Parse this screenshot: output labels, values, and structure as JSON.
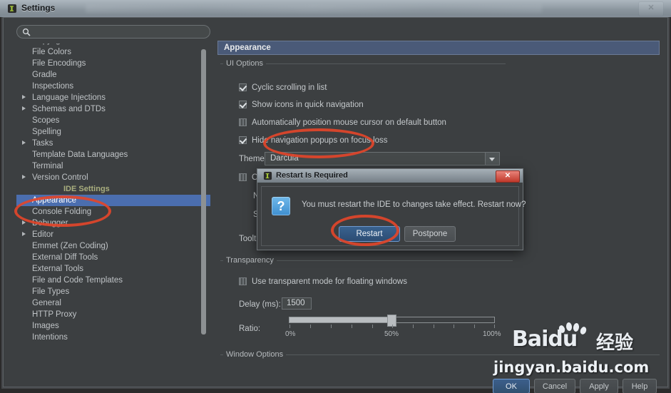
{
  "window": {
    "title": "Settings",
    "app_icon": "intellij-icon",
    "close_label": "✕"
  },
  "search": {
    "value": "",
    "placeholder": "",
    "icon": "search-icon"
  },
  "tree": {
    "items": [
      {
        "label": "Copyright",
        "expandable": true,
        "selected": false,
        "group": false
      },
      {
        "label": "File Colors",
        "expandable": false,
        "selected": false,
        "group": false
      },
      {
        "label": "File Encodings",
        "expandable": false,
        "selected": false,
        "group": false
      },
      {
        "label": "Gradle",
        "expandable": false,
        "selected": false,
        "group": false
      },
      {
        "label": "Inspections",
        "expandable": false,
        "selected": false,
        "group": false
      },
      {
        "label": "Language Injections",
        "expandable": true,
        "selected": false,
        "group": false
      },
      {
        "label": "Schemas and DTDs",
        "expandable": true,
        "selected": false,
        "group": false
      },
      {
        "label": "Scopes",
        "expandable": false,
        "selected": false,
        "group": false
      },
      {
        "label": "Spelling",
        "expandable": false,
        "selected": false,
        "group": false
      },
      {
        "label": "Tasks",
        "expandable": true,
        "selected": false,
        "group": false
      },
      {
        "label": "Template Data Languages",
        "expandable": false,
        "selected": false,
        "group": false
      },
      {
        "label": "Terminal",
        "expandable": false,
        "selected": false,
        "group": false
      },
      {
        "label": "Version Control",
        "expandable": true,
        "selected": false,
        "group": false
      },
      {
        "label": "IDE Settings",
        "expandable": false,
        "selected": false,
        "group": true
      },
      {
        "label": "Appearance",
        "expandable": false,
        "selected": true,
        "group": false
      },
      {
        "label": "Console Folding",
        "expandable": false,
        "selected": false,
        "group": false
      },
      {
        "label": "Debugger",
        "expandable": true,
        "selected": false,
        "group": false
      },
      {
        "label": "Editor",
        "expandable": true,
        "selected": false,
        "group": false
      },
      {
        "label": "Emmet (Zen Coding)",
        "expandable": false,
        "selected": false,
        "group": false
      },
      {
        "label": "External Diff Tools",
        "expandable": false,
        "selected": false,
        "group": false
      },
      {
        "label": "External Tools",
        "expandable": false,
        "selected": false,
        "group": false
      },
      {
        "label": "File and Code Templates",
        "expandable": false,
        "selected": false,
        "group": false
      },
      {
        "label": "File Types",
        "expandable": false,
        "selected": false,
        "group": false
      },
      {
        "label": "General",
        "expandable": false,
        "selected": false,
        "group": false
      },
      {
        "label": "HTTP Proxy",
        "expandable": false,
        "selected": false,
        "group": false
      },
      {
        "label": "Images",
        "expandable": false,
        "selected": false,
        "group": false
      },
      {
        "label": "Intentions",
        "expandable": false,
        "selected": false,
        "group": false
      }
    ]
  },
  "pane": {
    "header": "Appearance"
  },
  "ui_options": {
    "legend": "UI Options",
    "checkboxes": [
      {
        "label": "Cyclic scrolling in list",
        "checked": true
      },
      {
        "label": "Show icons in quick navigation",
        "checked": true
      },
      {
        "label": "Automatically position mouse cursor on default button",
        "checked": false
      },
      {
        "label": "Hide navigation popups on focus loss",
        "checked": true
      }
    ],
    "theme_label": "Theme:",
    "theme_value": "Darcula",
    "override_fonts_label": "Override default fonts by (not recommended):",
    "override_fonts_checked": false,
    "name_label": "Na",
    "size_label": "Siz",
    "tooltip_label": "Tooltip"
  },
  "transparency": {
    "legend": "Transparency",
    "checkbox_label": "Use transparent mode for floating windows",
    "checkbox_checked": false,
    "delay_label": "Delay (ms):",
    "delay_value": "1500",
    "ratio_label": "Ratio:",
    "ratio_percent": 50,
    "tick_labels": [
      "0%",
      "50%",
      "100%"
    ]
  },
  "window_options": {
    "legend": "Window Options"
  },
  "dialog": {
    "title": "Restart Is Required",
    "icon": "question-icon",
    "close_label": "✕",
    "message": "You must restart the IDE to changes take effect. Restart now?",
    "primary_button": "Restart",
    "secondary_button": "Postpone"
  },
  "footer": {
    "ok": "OK",
    "cancel": "Cancel",
    "apply": "Apply",
    "help": "Help"
  },
  "watermark": {
    "brand": "Baidu",
    "brand_cn": "经验",
    "url": "jingyan.baidu.com",
    "icon": "paw-icon"
  },
  "colors": {
    "window_bg": "#3c3f41",
    "selection_blue": "#4b6eaf",
    "header_blue": "#4a5a78",
    "annotation_red": "#e2452a",
    "close_red": "#c0392b"
  }
}
